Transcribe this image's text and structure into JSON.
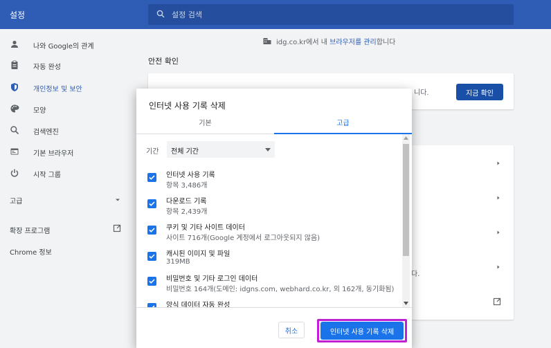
{
  "header": {
    "title": "설정",
    "search_placeholder": "설정 검색"
  },
  "sidebar": {
    "items": [
      {
        "label": "나와 Google의 관계",
        "icon": "person-icon"
      },
      {
        "label": "자동 완성",
        "icon": "clipboard-icon"
      },
      {
        "label": "개인정보 및 보안",
        "icon": "shield-icon"
      },
      {
        "label": "모양",
        "icon": "palette-icon"
      },
      {
        "label": "검색엔진",
        "icon": "search-icon"
      },
      {
        "label": "기본 브라우저",
        "icon": "browser-icon"
      },
      {
        "label": "시작 그룹",
        "icon": "power-icon"
      }
    ],
    "advanced": "고급",
    "extensions": "확장 프로그램",
    "about": "Chrome 정보"
  },
  "main": {
    "managed_prefix": "idg.co.kr에서 내 ",
    "managed_link": "브라우저를 관리",
    "managed_suffix": "합니다",
    "safety_title": "안전 확인",
    "safety_tail": "니다.",
    "check_now": "지금 확인",
    "lower_tail": "다."
  },
  "dialog": {
    "title": "인터넷 사용 기록 삭제",
    "tabs": [
      "기본",
      "고급"
    ],
    "active_tab": "고급",
    "range_label": "기간",
    "range_value": "전체 기간",
    "items": [
      {
        "title": "인터넷 사용 기록",
        "sub": "항목 3,486개",
        "checked": true
      },
      {
        "title": "다운로드 기록",
        "sub": "항목 2,439개",
        "checked": true
      },
      {
        "title": "쿠키 및 기타 사이트 데이터",
        "sub": "사이트 716개(Google 계정에서 로그아웃되지 않음)",
        "checked": true
      },
      {
        "title": "캐시된 이미지 및 파일",
        "sub": "319MB",
        "checked": true
      },
      {
        "title": "비밀번호 및 기타 로그인 데이터",
        "sub": "비밀번호 164개(도메인: idgns.com, webhard.co.kr, 외 162개, 동기화됨)",
        "checked": true
      },
      {
        "title": "양식 데이터 자동 완성",
        "sub": "",
        "checked": true
      }
    ],
    "cancel": "취소",
    "confirm": "인터넷 사용 기록 삭제"
  },
  "colors": {
    "header": "#2f5cb4",
    "accent": "#1a73e8",
    "highlight": "#c01fd3"
  }
}
